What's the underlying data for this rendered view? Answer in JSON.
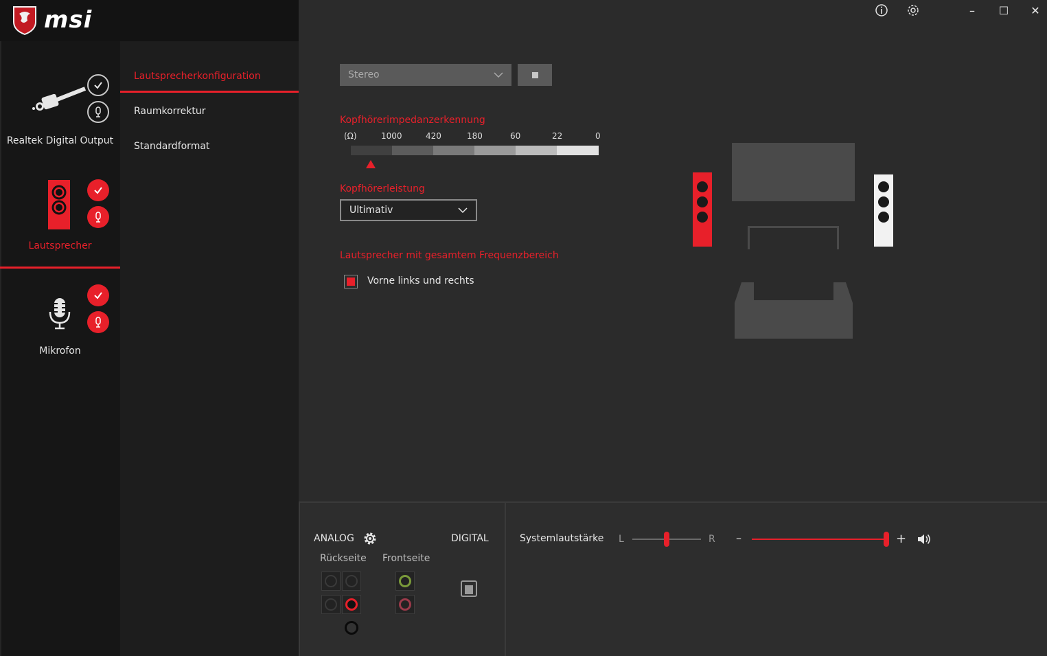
{
  "app": {
    "brand": "msi"
  },
  "window_controls": {
    "info_icon": "info-icon",
    "settings_icon": "gear-icon",
    "minimize": "–",
    "maximize": "☐",
    "close": "✕"
  },
  "devices": [
    {
      "label": "Realtek Digital Output",
      "active": false
    },
    {
      "label": "Lautsprecher",
      "active": true
    },
    {
      "label": "Mikrofon",
      "active": false
    }
  ],
  "submenu": {
    "items": [
      "Lautsprecherkonfiguration",
      "Raumkorrektur",
      "Standardformat"
    ],
    "active_index": 0
  },
  "speaker_config": {
    "mode_value": "Stereo",
    "impedance_title": "Kopfhörerimpedanzerkennung",
    "impedance_unit": "(Ω)",
    "impedance_ticks": [
      "1000",
      "420",
      "180",
      "60",
      "22",
      "0"
    ],
    "power_title": "Kopfhörerleistung",
    "power_value": "Ultimativ",
    "fullrange_title": "Lautsprecher mit gesamtem Frequenzbereich",
    "fullrange_option": "Vorne links und rechts",
    "fullrange_checked": true
  },
  "bottom": {
    "analog_label": "ANALOG",
    "digital_label": "DIGITAL",
    "rear_label": "Rückseite",
    "front_label": "Frontseite",
    "system_volume_label": "Systemlautstärke",
    "balance_left": "L",
    "balance_right": "R",
    "minus": "–",
    "plus": "+",
    "balance_value": 0.5,
    "volume_value": 1.0
  },
  "colors": {
    "accent": "#e8202a",
    "bg": "#2b2b2b",
    "rail": "#161616"
  }
}
